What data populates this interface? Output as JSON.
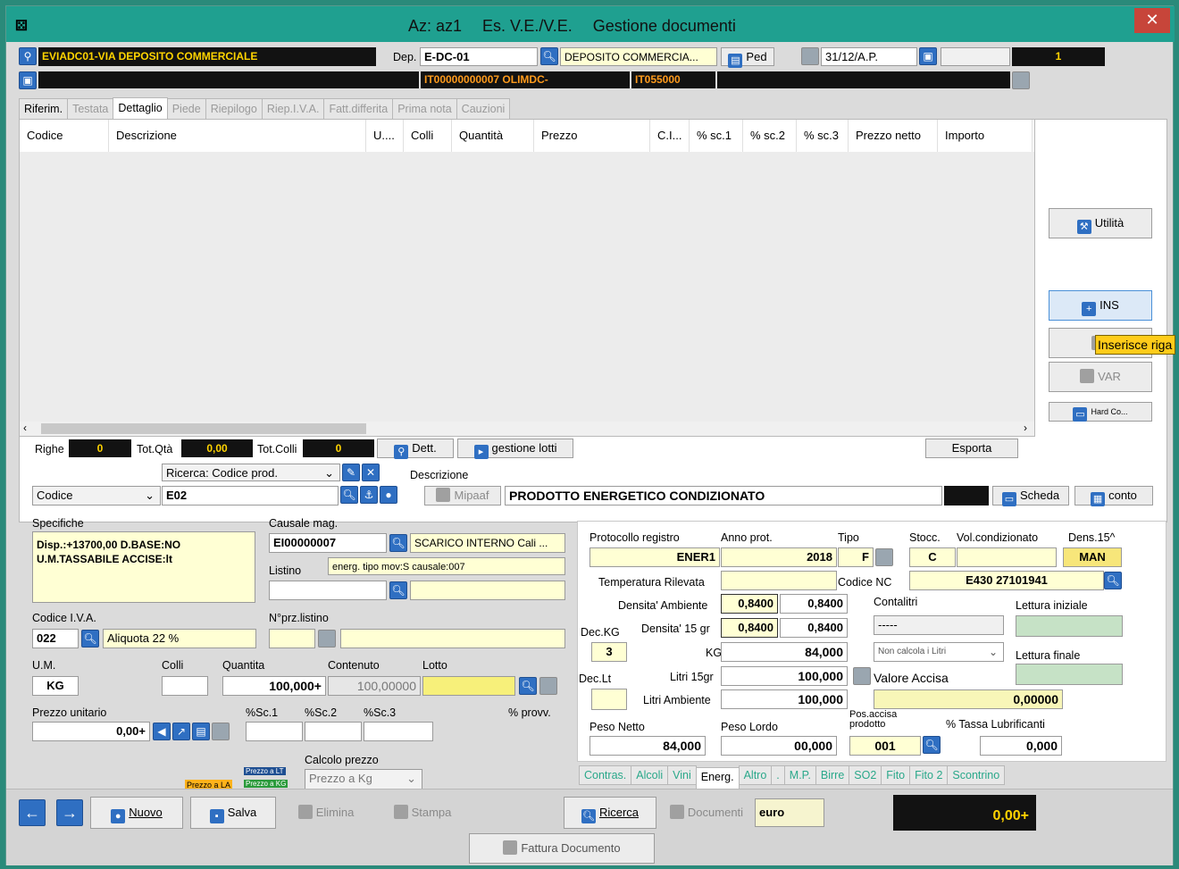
{
  "window": {
    "app_logo": "⚄",
    "title_az": "Az: az1",
    "title_es": "Es. V.E./V.E.",
    "title_main": "Gestione documenti",
    "close": "✕"
  },
  "header": {
    "deposit_desc": "EVIADC01-VIA DEPOSITO COMMERCIALE",
    "dep_label": "Dep.",
    "dep_code": "E-DC-01",
    "dep_name": "DEPOSITO COMMERCIA...",
    "ped_label": "Ped",
    "date": "31/12/A.P.",
    "counter": "1",
    "row2_code": "IT00000000007 OLIMDC-",
    "row2_it": "IT055000"
  },
  "tabs": [
    "Riferim.",
    "Testata",
    "Dettaglio",
    "Piede",
    "Riepilogo",
    "Riep.I.V.A.",
    "Fatt.differita",
    "Prima nota",
    "Cauzioni"
  ],
  "grid": {
    "columns": [
      "Codice",
      "Descrizione",
      "U....",
      "Colli",
      "Quantità",
      "Prezzo",
      "C.I...",
      "% sc.1",
      "% sc.2",
      "% sc.3",
      "Prezzo netto",
      "Importo"
    ]
  },
  "side": {
    "utilita": "Utilità",
    "ins": "INS",
    "inserisce_tooltip": "Inserisce riga",
    "var": "VAR",
    "hardco": "Hard Co..."
  },
  "totals": {
    "righe_label": "Righe",
    "righe": "0",
    "totqta_label": "Tot.Qtà",
    "totqta": "0,00",
    "totcolli_label": "Tot.Colli",
    "totcolli": "0",
    "dett": "Dett.",
    "gestione_lotti": "gestione lotti",
    "esporta": "Esporta"
  },
  "search": {
    "ricerca_select": "Ricerca: Codice prod.",
    "descrizione_label": "Descrizione",
    "codice_select": "Codice",
    "code_value": "E02",
    "mipaaf": "Mipaaf",
    "description": "PRODOTTO ENERGETICO CONDIZIONATO",
    "scheda": "Scheda",
    "conto": "conto"
  },
  "detail": {
    "specifiche_label": "Specifiche",
    "specifiche_line1": "Disp.:+13700,00 D.BASE:NO",
    "specifiche_line2": "U.M.TASSABILE ACCISE:lt",
    "causale_label": "Causale mag.",
    "causale_code": "EI00000007",
    "causale_desc": "SCARICO INTERNO Cali ...",
    "listino_label": "Listino",
    "listino_note": "energ. tipo mov:S causale:007",
    "codice_iva_label": "Codice I.V.A.",
    "iva_code": "022",
    "iva_desc": "Aliquota 22 %",
    "nprz_label": "N°prz.listino",
    "um_label": "U.M.",
    "um_value": "KG",
    "colli_label": "Colli",
    "quantita_label": "Quantita",
    "quantita_value": "100,000+",
    "contenuto_label": "Contenuto",
    "contenuto_value": "100,00000",
    "lotto_label": "Lotto",
    "prezzo_unit_label": "Prezzo unitario",
    "prezzo_unit_value": "0,00+",
    "sc1_label": "%Sc.1",
    "sc2_label": "%Sc.2",
    "sc3_label": "%Sc.3",
    "provv_label": "% provv.",
    "calcolo_label": "Calcolo prezzo",
    "prezzo_la": "Prezzo a LA",
    "prezzo_lt": "Prezzo a LT",
    "prezzo_kg": "Prezzo a KG",
    "prezzo_a_select": "Prezzo a  Kg"
  },
  "energia": {
    "protocollo_label": "Protocollo registro",
    "protocollo_value": "ENER1",
    "anno_label": "Anno prot.",
    "anno_value": "2018",
    "tipo_label": "Tipo",
    "tipo_value": "F",
    "stocc_label": "Stocc.",
    "stocc_value": "C",
    "vol_label": "Vol.condizionato",
    "dens_label": "Dens.15^",
    "dens_value": "MAN",
    "temp_label": "Temperatura Rilevata",
    "codice_nc_label": "Codice  NC",
    "codice_nc_value": "E430 27101941",
    "dens_amb_label": "Densita' Ambiente",
    "dens_amb_1": "0,8400",
    "dens_amb_2": "0,8400",
    "contalitri_label": "Contalitri",
    "contalitri_value": "-----",
    "lettura_iniziale_label": "Lettura iniziale",
    "dec_kg_label": "Dec.KG",
    "dec_kg_value": "3",
    "dens15_label": "Densita' 15 gr",
    "dens15_1": "0,8400",
    "dens15_2": "0,8400",
    "kg_label": "KG",
    "kg_value": "84,000",
    "non_calcola": "Non calcola i Litri",
    "lettura_finale_label": "Lettura finale",
    "dec_lt_label": "Dec.Lt",
    "litri15_label": "Litri 15gr",
    "litri15_value": "100,000",
    "valore_accisa_label": "Valore Accisa",
    "litri_amb_label": "Litri Ambiente",
    "litri_amb_value": "100,000",
    "valore_accisa_value": "0,00000",
    "peso_netto_label": "Peso Netto",
    "peso_netto_value": "84,000",
    "peso_lordo_label": "Peso Lordo",
    "peso_lordo_value": "00,000",
    "pos_accisa_label": "Pos.accisa prodotto",
    "pos_accisa_value": "001",
    "tassa_label": "% Tassa Lubrificanti",
    "tassa_value": "0,000"
  },
  "bottom_tabs": [
    "Contras.",
    "Alcoli",
    "Vini",
    "Energ.",
    "Altro",
    ".",
    "M.P.",
    "Birre",
    "SO2",
    "Fito",
    "Fito 2",
    "Scontrino"
  ],
  "footer": {
    "nuovo": "Nuovo",
    "salva": "Salva",
    "elimina": "Elimina",
    "stampa": "Stampa",
    "ricerca": "Ricerca",
    "documenti": "Documenti",
    "currency": "euro",
    "total": "0,00+",
    "fattura": "Fattura Documento"
  },
  "colors": {
    "titlebar": "#1fa090",
    "accent_blue": "#2f6fc2",
    "dark": "#121212",
    "yellow_text": "#ffd400"
  }
}
